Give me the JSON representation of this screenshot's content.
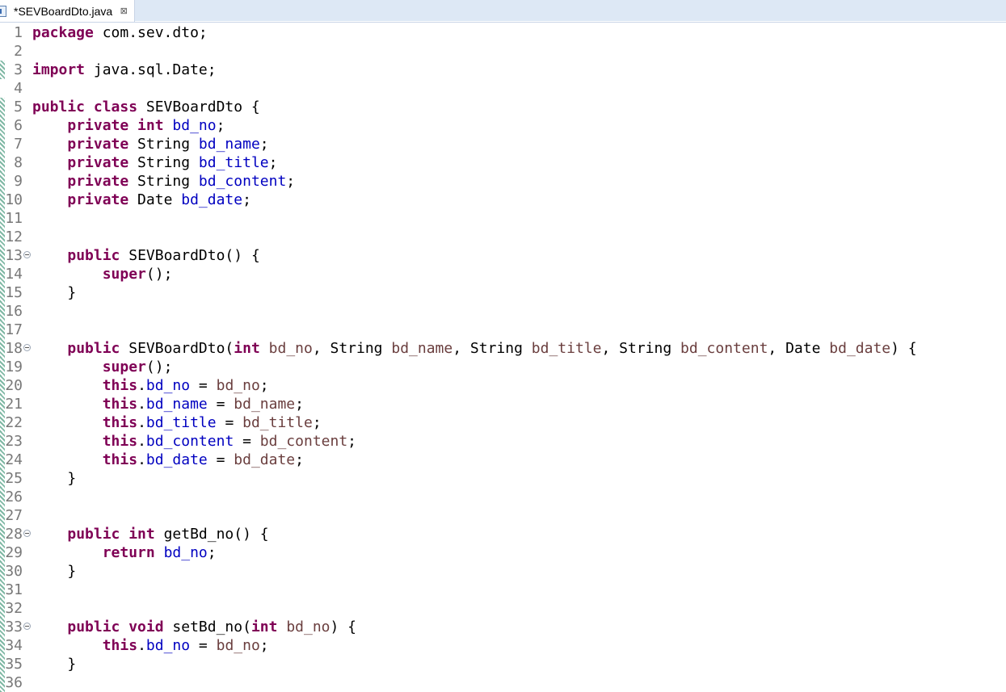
{
  "tab": {
    "title": "*SEVBoardDto.java",
    "icon": "java-file-icon",
    "close_icon": "close-icon",
    "close_glyph": "⊠"
  },
  "colors": {
    "keyword": "#7f0055",
    "field": "#0000c0",
    "parameter": "#6a3e3e",
    "plain": "#000000",
    "line_number": "#787878",
    "tabbar": "#dde8f5"
  },
  "editor": {
    "lines": [
      {
        "n": "1",
        "fold": false,
        "stripe": false,
        "tokens": [
          [
            "kw",
            "package"
          ],
          [
            "pl",
            " com.sev.dto;"
          ]
        ]
      },
      {
        "n": "2",
        "fold": false,
        "stripe": false,
        "tokens": []
      },
      {
        "n": "3",
        "fold": false,
        "stripe": true,
        "tokens": [
          [
            "kw",
            "import"
          ],
          [
            "pl",
            " java.sql.Date;"
          ]
        ]
      },
      {
        "n": "4",
        "fold": false,
        "stripe": false,
        "tokens": []
      },
      {
        "n": "5",
        "fold": false,
        "stripe": true,
        "tokens": [
          [
            "kw",
            "public class"
          ],
          [
            "pl",
            " SEVBoardDto {"
          ]
        ]
      },
      {
        "n": "6",
        "fold": false,
        "stripe": true,
        "tokens": [
          [
            "pl",
            "    "
          ],
          [
            "kw",
            "private int"
          ],
          [
            "pl",
            " "
          ],
          [
            "fld",
            "bd_no"
          ],
          [
            "pl",
            ";"
          ]
        ]
      },
      {
        "n": "7",
        "fold": false,
        "stripe": true,
        "tokens": [
          [
            "pl",
            "    "
          ],
          [
            "kw",
            "private"
          ],
          [
            "pl",
            " String "
          ],
          [
            "fld",
            "bd_name"
          ],
          [
            "pl",
            ";"
          ]
        ]
      },
      {
        "n": "8",
        "fold": false,
        "stripe": true,
        "tokens": [
          [
            "pl",
            "    "
          ],
          [
            "kw",
            "private"
          ],
          [
            "pl",
            " String "
          ],
          [
            "fld",
            "bd_title"
          ],
          [
            "pl",
            ";"
          ]
        ]
      },
      {
        "n": "9",
        "fold": false,
        "stripe": true,
        "tokens": [
          [
            "pl",
            "    "
          ],
          [
            "kw",
            "private"
          ],
          [
            "pl",
            " String "
          ],
          [
            "fld",
            "bd_content"
          ],
          [
            "pl",
            ";"
          ]
        ]
      },
      {
        "n": "10",
        "fold": false,
        "stripe": true,
        "tokens": [
          [
            "pl",
            "    "
          ],
          [
            "kw",
            "private"
          ],
          [
            "pl",
            " Date "
          ],
          [
            "fld",
            "bd_date"
          ],
          [
            "pl",
            ";"
          ]
        ]
      },
      {
        "n": "11",
        "fold": false,
        "stripe": true,
        "tokens": []
      },
      {
        "n": "12",
        "fold": false,
        "stripe": true,
        "tokens": []
      },
      {
        "n": "13",
        "fold": true,
        "stripe": true,
        "tokens": [
          [
            "pl",
            "    "
          ],
          [
            "kw",
            "public"
          ],
          [
            "pl",
            " SEVBoardDto() {"
          ]
        ]
      },
      {
        "n": "14",
        "fold": false,
        "stripe": true,
        "tokens": [
          [
            "pl",
            "        "
          ],
          [
            "kw",
            "super"
          ],
          [
            "pl",
            "();"
          ]
        ]
      },
      {
        "n": "15",
        "fold": false,
        "stripe": true,
        "tokens": [
          [
            "pl",
            "    }"
          ]
        ]
      },
      {
        "n": "16",
        "fold": false,
        "stripe": true,
        "tokens": []
      },
      {
        "n": "17",
        "fold": false,
        "stripe": true,
        "tokens": []
      },
      {
        "n": "18",
        "fold": true,
        "stripe": true,
        "tokens": [
          [
            "pl",
            "    "
          ],
          [
            "kw",
            "public"
          ],
          [
            "pl",
            " SEVBoardDto("
          ],
          [
            "kw",
            "int"
          ],
          [
            "pl",
            " "
          ],
          [
            "par",
            "bd_no"
          ],
          [
            "pl",
            ", String "
          ],
          [
            "par",
            "bd_name"
          ],
          [
            "pl",
            ", String "
          ],
          [
            "par",
            "bd_title"
          ],
          [
            "pl",
            ", String "
          ],
          [
            "par",
            "bd_content"
          ],
          [
            "pl",
            ", Date "
          ],
          [
            "par",
            "bd_date"
          ],
          [
            "pl",
            ") {"
          ]
        ]
      },
      {
        "n": "19",
        "fold": false,
        "stripe": true,
        "tokens": [
          [
            "pl",
            "        "
          ],
          [
            "kw",
            "super"
          ],
          [
            "pl",
            "();"
          ]
        ]
      },
      {
        "n": "20",
        "fold": false,
        "stripe": true,
        "tokens": [
          [
            "pl",
            "        "
          ],
          [
            "kw",
            "this"
          ],
          [
            "pl",
            "."
          ],
          [
            "fld",
            "bd_no"
          ],
          [
            "pl",
            " = "
          ],
          [
            "par",
            "bd_no"
          ],
          [
            "pl",
            ";"
          ]
        ]
      },
      {
        "n": "21",
        "fold": false,
        "stripe": true,
        "tokens": [
          [
            "pl",
            "        "
          ],
          [
            "kw",
            "this"
          ],
          [
            "pl",
            "."
          ],
          [
            "fld",
            "bd_name"
          ],
          [
            "pl",
            " = "
          ],
          [
            "par",
            "bd_name"
          ],
          [
            "pl",
            ";"
          ]
        ]
      },
      {
        "n": "22",
        "fold": false,
        "stripe": true,
        "tokens": [
          [
            "pl",
            "        "
          ],
          [
            "kw",
            "this"
          ],
          [
            "pl",
            "."
          ],
          [
            "fld",
            "bd_title"
          ],
          [
            "pl",
            " = "
          ],
          [
            "par",
            "bd_title"
          ],
          [
            "pl",
            ";"
          ]
        ]
      },
      {
        "n": "23",
        "fold": false,
        "stripe": true,
        "tokens": [
          [
            "pl",
            "        "
          ],
          [
            "kw",
            "this"
          ],
          [
            "pl",
            "."
          ],
          [
            "fld",
            "bd_content"
          ],
          [
            "pl",
            " = "
          ],
          [
            "par",
            "bd_content"
          ],
          [
            "pl",
            ";"
          ]
        ]
      },
      {
        "n": "24",
        "fold": false,
        "stripe": true,
        "tokens": [
          [
            "pl",
            "        "
          ],
          [
            "kw",
            "this"
          ],
          [
            "pl",
            "."
          ],
          [
            "fld",
            "bd_date"
          ],
          [
            "pl",
            " = "
          ],
          [
            "par",
            "bd_date"
          ],
          [
            "pl",
            ";"
          ]
        ]
      },
      {
        "n": "25",
        "fold": false,
        "stripe": true,
        "tokens": [
          [
            "pl",
            "    }"
          ]
        ]
      },
      {
        "n": "26",
        "fold": false,
        "stripe": true,
        "tokens": []
      },
      {
        "n": "27",
        "fold": false,
        "stripe": true,
        "tokens": []
      },
      {
        "n": "28",
        "fold": true,
        "stripe": true,
        "tokens": [
          [
            "pl",
            "    "
          ],
          [
            "kw",
            "public int"
          ],
          [
            "pl",
            " getBd_no() {"
          ]
        ]
      },
      {
        "n": "29",
        "fold": false,
        "stripe": true,
        "tokens": [
          [
            "pl",
            "        "
          ],
          [
            "kw",
            "return"
          ],
          [
            "pl",
            " "
          ],
          [
            "fld",
            "bd_no"
          ],
          [
            "pl",
            ";"
          ]
        ]
      },
      {
        "n": "30",
        "fold": false,
        "stripe": true,
        "tokens": [
          [
            "pl",
            "    }"
          ]
        ]
      },
      {
        "n": "31",
        "fold": false,
        "stripe": true,
        "tokens": []
      },
      {
        "n": "32",
        "fold": false,
        "stripe": true,
        "tokens": []
      },
      {
        "n": "33",
        "fold": true,
        "stripe": true,
        "tokens": [
          [
            "pl",
            "    "
          ],
          [
            "kw",
            "public void"
          ],
          [
            "pl",
            " setBd_no("
          ],
          [
            "kw",
            "int"
          ],
          [
            "pl",
            " "
          ],
          [
            "par",
            "bd_no"
          ],
          [
            "pl",
            ") {"
          ]
        ]
      },
      {
        "n": "34",
        "fold": false,
        "stripe": true,
        "tokens": [
          [
            "pl",
            "        "
          ],
          [
            "kw",
            "this"
          ],
          [
            "pl",
            "."
          ],
          [
            "fld",
            "bd_no"
          ],
          [
            "pl",
            " = "
          ],
          [
            "par",
            "bd_no"
          ],
          [
            "pl",
            ";"
          ]
        ]
      },
      {
        "n": "35",
        "fold": false,
        "stripe": true,
        "tokens": [
          [
            "pl",
            "    }"
          ]
        ]
      },
      {
        "n": "36",
        "fold": false,
        "stripe": true,
        "tokens": []
      }
    ]
  }
}
